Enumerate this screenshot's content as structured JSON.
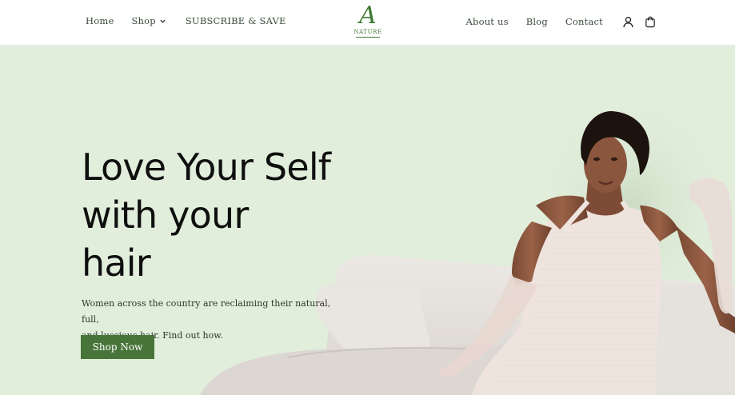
{
  "header": {
    "nav_left": [
      {
        "label": "Home"
      },
      {
        "label": "Shop"
      },
      {
        "label": "SUBSCRIBE & SAVE"
      }
    ],
    "nav_right": [
      {
        "label": "About us"
      },
      {
        "label": "Blog"
      },
      {
        "label": "Contact"
      }
    ],
    "logo": {
      "mark": "A",
      "text": "NATURE"
    },
    "icons": [
      "user-icon",
      "cart-icon",
      "chevron-down-icon"
    ]
  },
  "hero": {
    "title_lines": [
      "Love Your Self",
      "with your",
      "hair"
    ],
    "subtitle_line1": "Women across the country are reclaiming their natural, full,",
    "subtitle_line2": "and luscious hair. Find out how.",
    "cta_label": "Shop Now"
  },
  "colors": {
    "brand_green": "#477539",
    "hero_background": "#e1eedb",
    "sofa": "#e6e2de",
    "dress": "#f0e6e1"
  }
}
